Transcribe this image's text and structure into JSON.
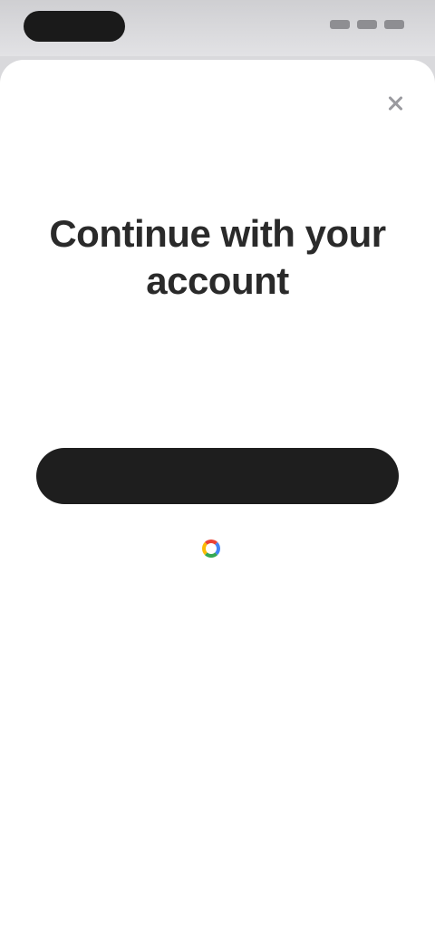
{
  "auth_sheet": {
    "title": "Continue with your account",
    "subtitle": "",
    "primary_button_label": "",
    "google_button_label": "",
    "footer_link_label": ""
  },
  "colors": {
    "primary_button": "#1e1e1e",
    "link": "#5aa6f0",
    "title": "#2a2a2a",
    "subtitle": "#a0a0a4"
  },
  "icons": {
    "close": "close-icon",
    "google": "google-icon"
  }
}
